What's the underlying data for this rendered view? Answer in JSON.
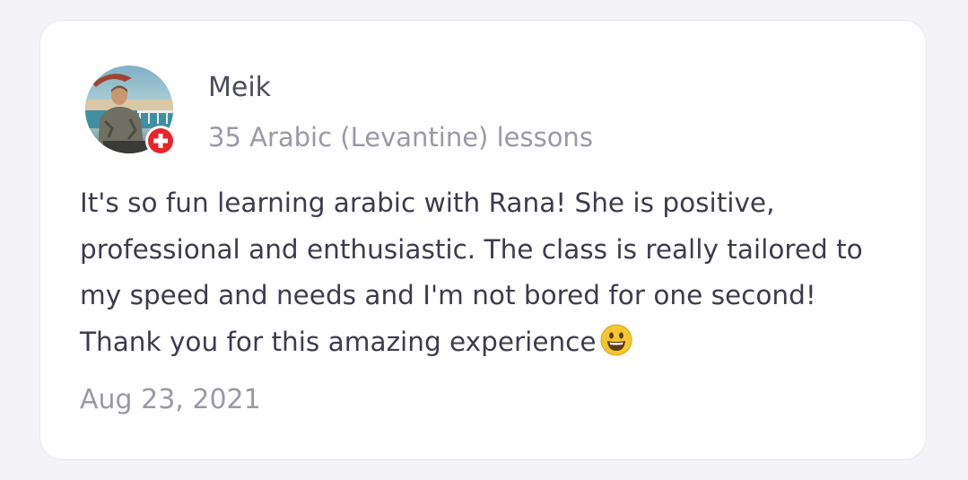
{
  "review": {
    "author": {
      "name": "Meik",
      "avatar": "user-photo",
      "country_flag": "switzerland-flag-icon"
    },
    "lessons_text": "35 Arabic (Levantine) lessons",
    "text": "It's so fun learning arabic with Rana! She is positive, professional and enthusiastic. The class is really tailored to my speed and needs and I'm not bored for one second! Thank you for this amazing experience",
    "emoji": "smiley-emoji-icon",
    "date": "Aug 23, 2021"
  },
  "colors": {
    "page_background": "#f4f4f8",
    "card_background": "#ffffff",
    "name_text": "#4d4c5c",
    "body_text": "#3d3c4d",
    "muted_text": "#9a99a6",
    "flag_red": "#e8252b"
  }
}
